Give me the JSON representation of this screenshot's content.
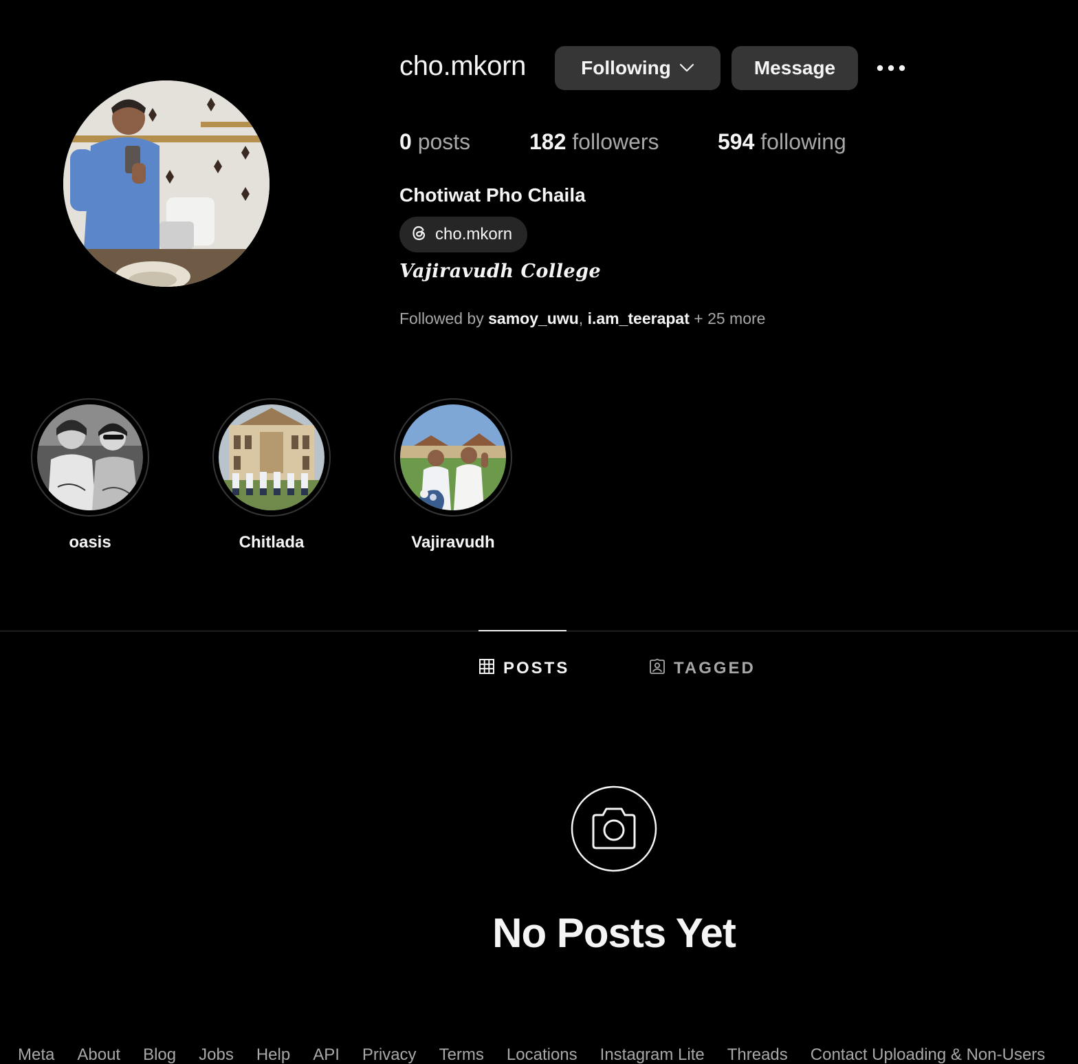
{
  "profile": {
    "username": "cho.mkorn",
    "following_button": "Following",
    "message_button": "Message",
    "stats": {
      "posts_count": "0",
      "posts_label": "posts",
      "followers_count": "182",
      "followers_label": "followers",
      "following_count": "594",
      "following_label": "following"
    },
    "full_name": "Chotiwat Pho Chaila",
    "threads_handle": "cho.mkorn",
    "bio": "Vajiravudh College",
    "followed_by": {
      "prefix": "Followed by ",
      "user1": "samoy_uwu",
      "separator": ", ",
      "user2": "i.am_teerapat",
      "more": " + 25 more"
    }
  },
  "highlights": [
    {
      "label": "oasis"
    },
    {
      "label": "Chitlada"
    },
    {
      "label": "Vajiravudh"
    }
  ],
  "tabs": {
    "posts": "POSTS",
    "tagged": "TAGGED",
    "active": "posts"
  },
  "empty_state": {
    "title": "No Posts Yet",
    "icon": "camera-icon"
  },
  "footer": {
    "links": [
      "Meta",
      "About",
      "Blog",
      "Jobs",
      "Help",
      "API",
      "Privacy",
      "Terms",
      "Locations",
      "Instagram Lite",
      "Threads",
      "Contact Uploading & Non-Users"
    ]
  },
  "icons": {
    "more": "more-options-icon",
    "chevron": "chevron-down-icon",
    "threads": "threads-icon",
    "grid": "grid-icon",
    "tagged": "tagged-icon"
  },
  "colors": {
    "background": "#000000",
    "button": "#363636",
    "text_primary": "#f5f5f5",
    "text_secondary": "#a8a8a8",
    "divider": "#363636"
  }
}
